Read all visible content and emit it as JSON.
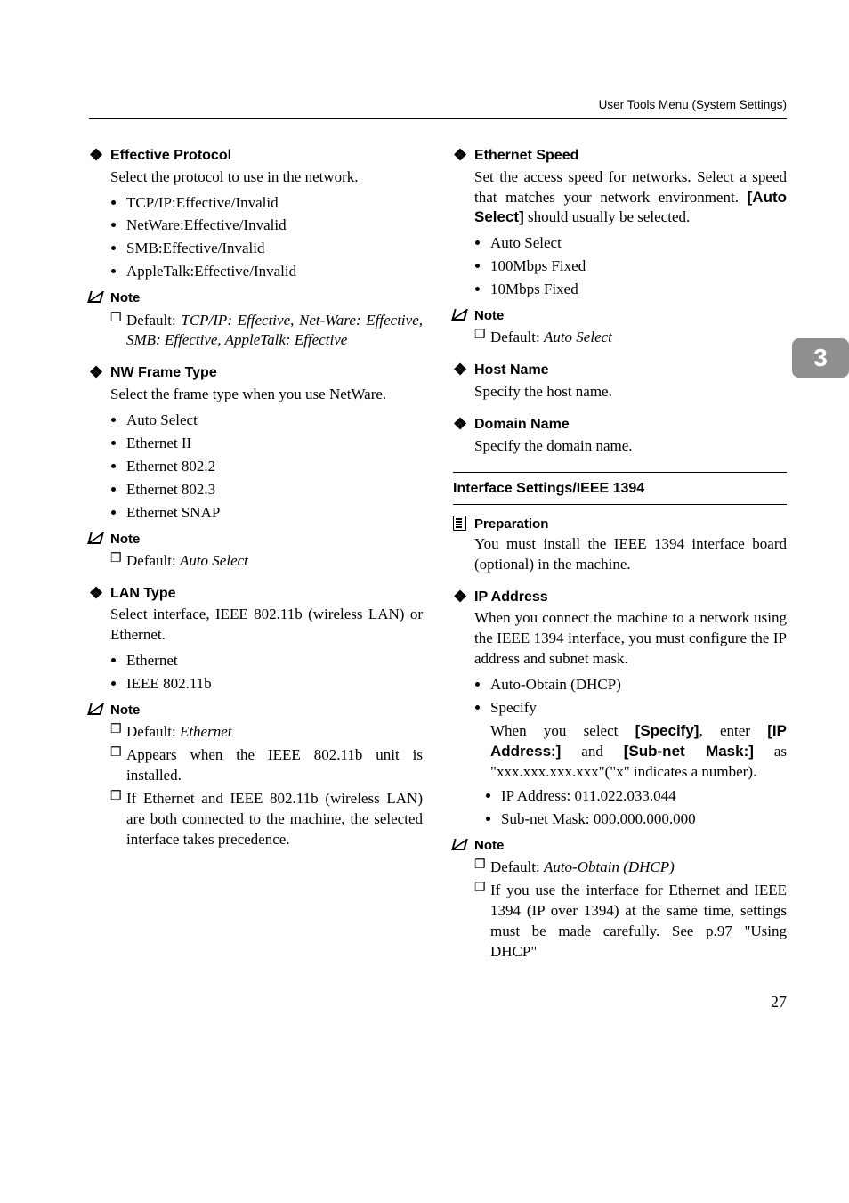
{
  "header": {
    "title": "User Tools Menu (System Settings)"
  },
  "side_tab": "3",
  "page_number": "27",
  "left": {
    "effective_protocol": {
      "title": "Effective Protocol",
      "desc": "Select the protocol to use in the network.",
      "items": [
        "TCP/IP:Effective/Invalid",
        "NetWare:Effective/Invalid",
        "SMB:Effective/Invalid",
        "AppleTalk:Effective/Invalid"
      ],
      "note_label": "Note",
      "note_default_pre": "Default: ",
      "note_default_val": "TCP/IP: Effective",
      "note_default_sep": ", ",
      "note_default_rest": "Net-Ware: Effective, SMB: Effective, AppleTalk: Effective"
    },
    "nw_frame": {
      "title": "NW Frame Type",
      "desc": "Select the frame type when you use NetWare.",
      "items": [
        "Auto Select",
        "Ethernet II",
        "Ethernet 802.2",
        "Ethernet 802.3",
        "Ethernet SNAP"
      ],
      "note_label": "Note",
      "note_default_pre": "Default: ",
      "note_default_val": "Auto Select"
    },
    "lan_type": {
      "title": "LAN Type",
      "desc": "Select interface, IEEE 802.11b (wireless LAN) or Ethernet.",
      "items": [
        "Ethernet",
        "IEEE 802.11b"
      ],
      "note_label": "Note",
      "notes": {
        "d1_pre": "Default: ",
        "d1_val": "Ethernet",
        "d2": "Appears when the IEEE 802.11b unit is installed.",
        "d3": "If Ethernet and IEEE 802.11b (wireless LAN) are both connected to the machine, the selected interface takes precedence."
      }
    }
  },
  "right": {
    "eth_speed": {
      "title": "Ethernet Speed",
      "desc_pre": "Set the access speed for networks. Select a speed that matches your network environment. ",
      "desc_bold": "[Auto Select]",
      "desc_post": " should usually be selected.",
      "items": [
        "Auto Select",
        "100Mbps Fixed",
        "10Mbps Fixed"
      ],
      "note_label": "Note",
      "note_default_pre": "Default: ",
      "note_default_val": "Auto Select"
    },
    "host_name": {
      "title": "Host Name",
      "desc": "Specify the host name."
    },
    "domain_name": {
      "title": "Domain Name",
      "desc": "Specify the domain name."
    },
    "section_ieee1394": "Interface Settings/IEEE 1394",
    "preparation": {
      "label": "Preparation",
      "text": "You must install the IEEE 1394 interface board (optional) in the machine."
    },
    "ip_address": {
      "title": "IP Address",
      "desc": "When you connect the machine to a network using the IEEE 1394 interface, you must configure the IP address and subnet mask.",
      "b1": "Auto-Obtain (DHCP)",
      "b2": "Specify",
      "spec_pre": "When you select ",
      "spec_b1": "[Specify]",
      "spec_mid1": ", enter ",
      "spec_b2": "[IP Address:]",
      "spec_mid2": " and ",
      "spec_b3": "[Sub-net Mask:]",
      "spec_post": " as \"xxx.xxx.xxx.xxx\"(\"x\" indicates a number).",
      "sub": [
        "IP Address: 011.022.033.044",
        "Sub-net Mask: 000.000.000.000"
      ],
      "note_label": "Note",
      "notes": {
        "d1_pre": "Default: ",
        "d1_val": "Auto-Obtain (DHCP)",
        "d2": "If you use the interface for Ethernet and IEEE 1394 (IP over 1394) at the same time, settings must be made carefully. See p.97 \"Using DHCP\""
      }
    }
  }
}
